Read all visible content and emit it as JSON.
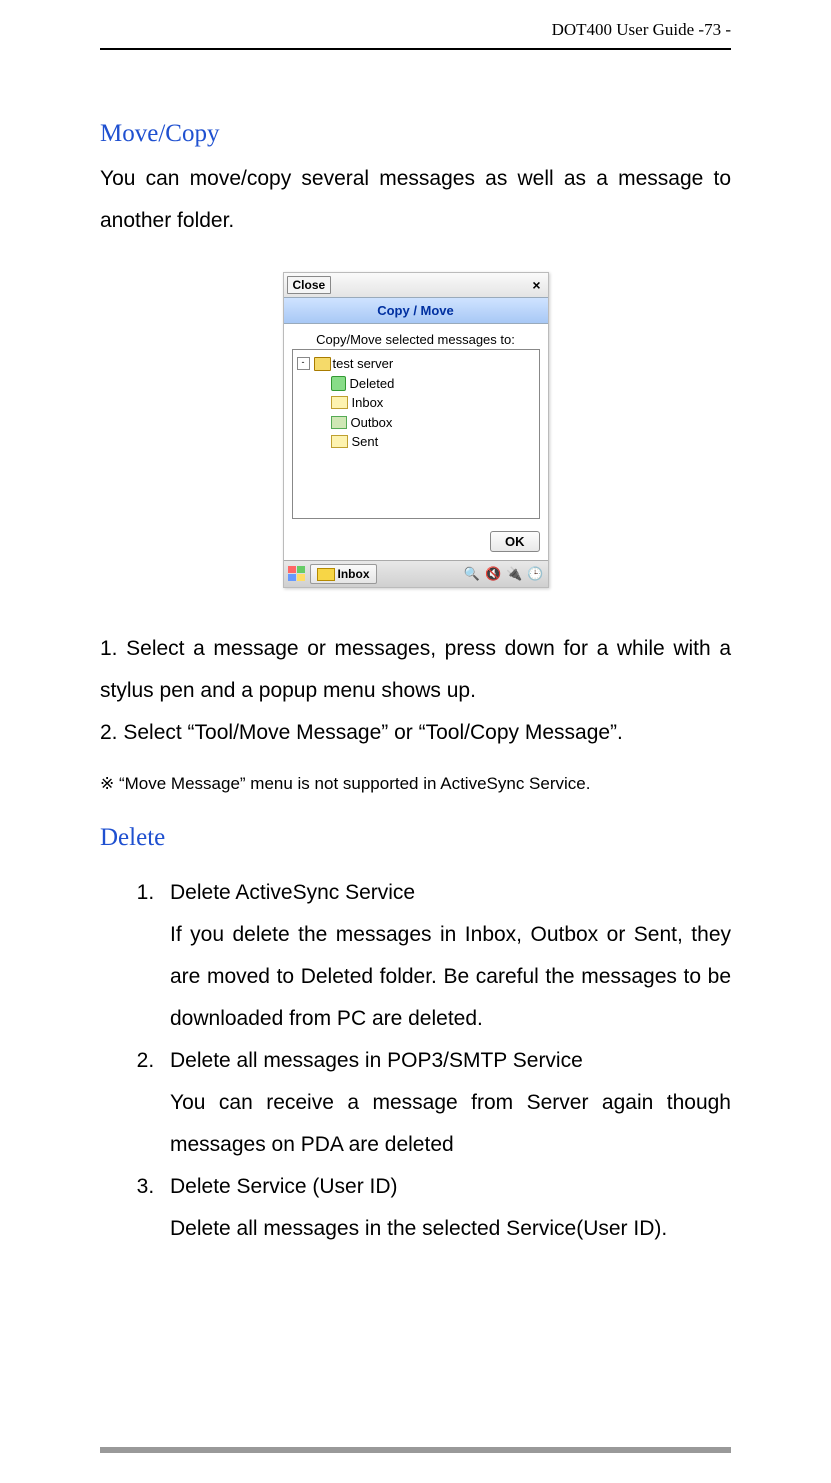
{
  "header": {
    "title": "DOT400 User Guide    -73 -"
  },
  "move_copy": {
    "heading": "Move/Copy",
    "intro": "You can move/copy several messages as well as a message to another folder.",
    "step1": "1. Select a message or messages, press down for a while with a stylus pen and a popup menu shows up.",
    "step2": "2. Select “Tool/Move Message” or “Tool/Copy Message”.",
    "note": "※ “Move Message” menu is not supported in ActiveSync Service."
  },
  "delete": {
    "heading": "Delete",
    "items": [
      {
        "title": "Delete ActiveSync Service",
        "desc": "If you delete the messages in Inbox, Outbox or Sent, they are moved to Deleted folder. Be careful the messages to be downloaded from PC are deleted."
      },
      {
        "title": "Delete all messages in POP3/SMTP Service",
        "desc": "You can receive a message from Server again though messages on PDA are deleted"
      },
      {
        "title": "Delete Service (User ID)",
        "desc": "Delete all messages in the selected Service(User ID)."
      }
    ]
  },
  "figure": {
    "close": "Close",
    "x": "×",
    "band": "Copy / Move",
    "prompt": "Copy/Move selected messages to:",
    "tree": {
      "root": "test server",
      "leaves": [
        "Deleted",
        "Inbox",
        "Outbox",
        "Sent"
      ]
    },
    "ok": "OK",
    "task_label": "Inbox",
    "tray_icons": [
      "🔍",
      "🔇",
      "🔌",
      "🕒"
    ]
  }
}
